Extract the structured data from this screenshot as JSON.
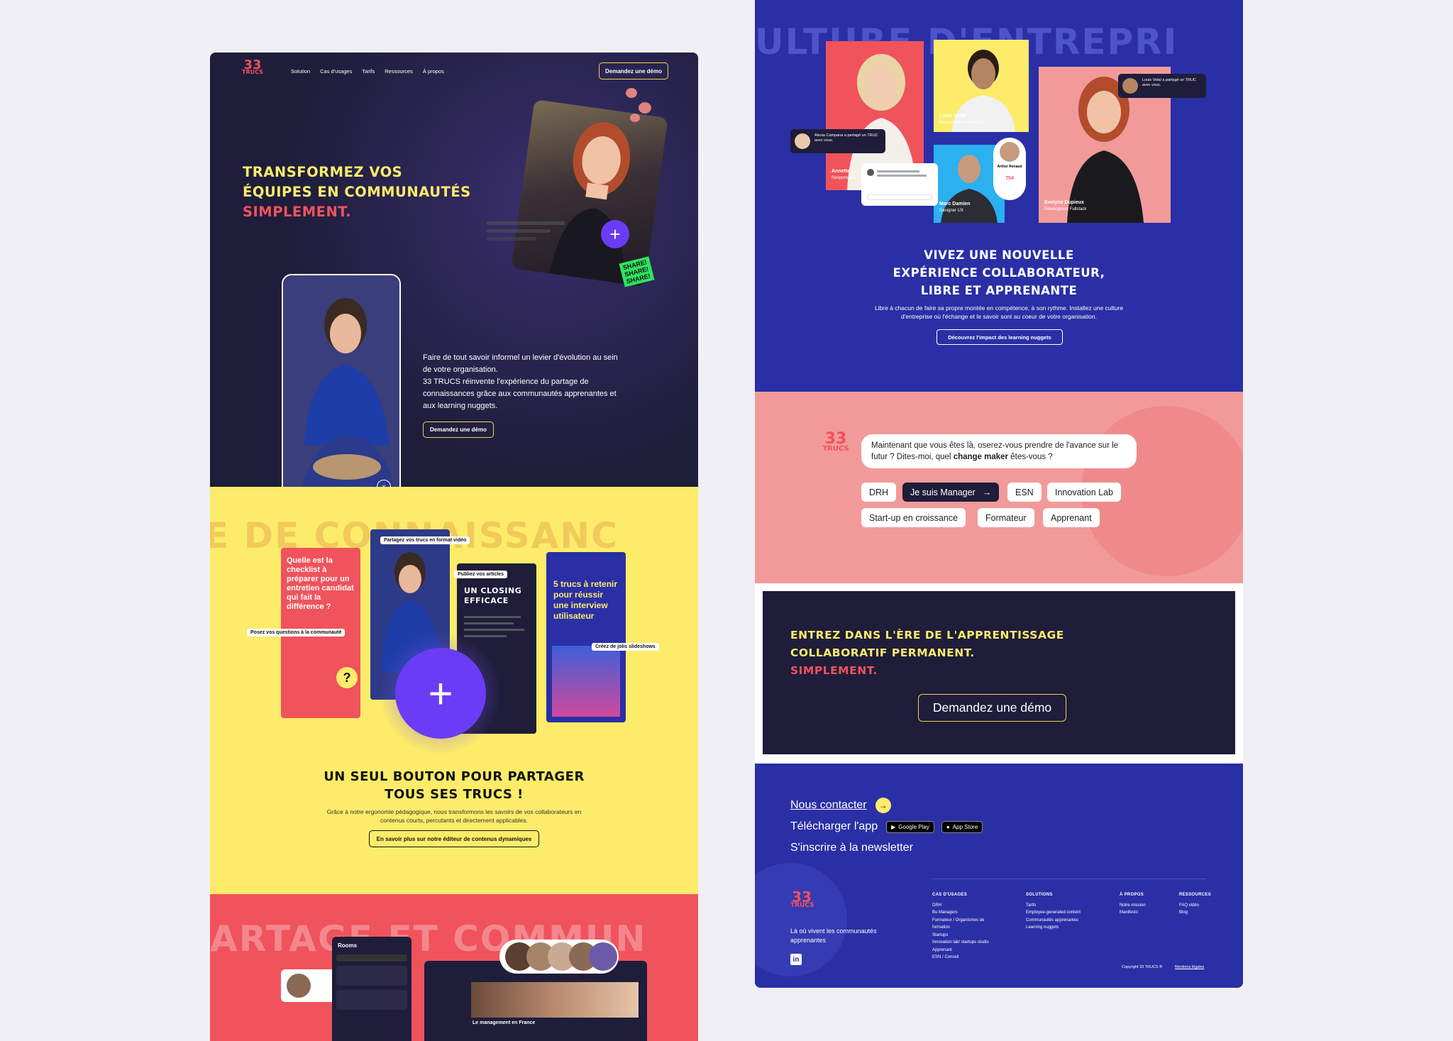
{
  "brand": {
    "logo_num": "33",
    "logo_word": "TRUCS"
  },
  "nav": {
    "items": [
      "Solution",
      "Cas d'usages",
      "Tarifs",
      "Ressources",
      "À propos"
    ],
    "cta": "Demandez une démo"
  },
  "hero": {
    "title_line1": "TRANSFORMEZ VOS",
    "title_line2": "ÉQUIPES EN COMMUNAUTÉS",
    "title_line3": "SIMPLEMENT.",
    "description": "Faire de tout savoir informel un levier d'évolution au sein de votre organisation.\n33 TRUCS réinvente l'expérience du partage de connaissances grâce aux communautés apprenantes et aux learning nuggets.",
    "cta": "Demandez une démo",
    "sticker": "SHARE!"
  },
  "share_section": {
    "bg_word": "E DE CONNAISSANC",
    "card1_text": "Quelle est la checklist à préparer pour un entretien candidat qui fait la différence ?",
    "card3_text": "UN CLOSING EFFICACE",
    "card4_text": "5 trucs à retenir pour réussir une interview utilisateur",
    "tag_video": "Partagez vos trucs en format vidéo",
    "tag_articles": "Publiez vos articles",
    "tag_questions": "Posez vos questions à la communauté",
    "tag_slides": "Créez de jolis slideshows",
    "title_line1": "UN SEUL BOUTON POUR PARTAGER",
    "title_line2": "TOUS SES TRUCS !",
    "description": "Grâce à notre ergonomie pédagogique, nous transformons les savoirs de vos collaborateurs en contenus courts, percutants et directement applicables.",
    "cta": "En savoir plus sur notre éditeur de contenus dynamiques"
  },
  "community_section": {
    "bg_word": "ARTAGE ET COMMUN",
    "rooms_title": "Rooms",
    "course_title": "Le management en France"
  },
  "culture_section": {
    "bg_word": "ULTURE D'ENTREPRI",
    "people": [
      {
        "name": "Louis Vidal",
        "role": "Responsable Marketing"
      },
      {
        "name": "Annette L",
        "role": "Responsable"
      },
      {
        "name": "Marc Damien",
        "role": "Designer UX"
      },
      {
        "name": "Evelyne Dupieux",
        "role": "Développeur Fullstack"
      },
      {
        "name": "Arthur Renaud",
        "role": ""
      }
    ],
    "notif1": "Alexia Campana a partagé un TRUC avec vous.",
    "notif2": "Louis Vidal a partagé un TRUC avec vous.",
    "count": "754",
    "title_line1": "VIVEZ UNE NOUVELLE",
    "title_line2": "EXPÉRIENCE COLLABORATEUR,",
    "title_line3": "LIBRE ET APPRENANTE",
    "description": "Libre à chacun de faire sa propre montée en compétence, à son rythme. Installez une culture d'entreprise où l'échange et le savoir sont au coeur de votre organisation.",
    "cta": "Découvrez l'impact des learning nuggets"
  },
  "chat_section": {
    "message_part1": "Maintenant que vous êtes là, oserez-vous prendre de l'avance sur le futur ? Dites-moi, quel ",
    "message_bold": "change maker",
    "message_part2": " êtes-vous ?",
    "chips_row1": [
      "DRH",
      "Je suis Manager",
      "ESN",
      "Innovation Lab"
    ],
    "chips_row2": [
      "Start-up en croissance",
      "Formateur",
      "Apprenant"
    ]
  },
  "cta_section": {
    "line1": "ENTREZ DANS L'ÈRE DE L'APPRENTISSAGE",
    "line2": "COLLABORATIF PERMANENT.",
    "line3": "SIMPLEMENT.",
    "button": "Demandez une démo"
  },
  "footer": {
    "contact": "Nous contacter",
    "app": "Télécharger l'app",
    "google_play": "Google Play",
    "app_store": "App Store",
    "newsletter": "S'inscrire à la newsletter",
    "tagline": "Là où vivent les communautés apprenantes",
    "columns": [
      {
        "title": "CAS D'USAGES",
        "items": [
          "DRH",
          "Bu Managers",
          "Formateur / Organismes de formation",
          "Startups",
          "Innovation lab/ startups studio",
          "Apprenant",
          "ESN / Conseil"
        ]
      },
      {
        "title": "SOLUTIONS",
        "items": [
          "Tarifs",
          "Employee-generated content",
          "Communautés apprenantes",
          "Learning nuggets"
        ]
      },
      {
        "title": "À PROPOS",
        "items": [
          "Notre mission",
          "Manifesto"
        ]
      },
      {
        "title": "RESSOURCES",
        "items": [
          "FAQ vidéo",
          "Blog"
        ]
      }
    ],
    "copyright": "Copyright 33 TRUCS ®",
    "legal": "Mentions légales",
    "linkedin": "in"
  },
  "colors": {
    "navy": "#1e1d3a",
    "yellow": "#fcec6a",
    "red": "#f0535c",
    "blue": "#2a2fa6",
    "pink": "#f29a9a",
    "purple": "#6b3cf5"
  }
}
